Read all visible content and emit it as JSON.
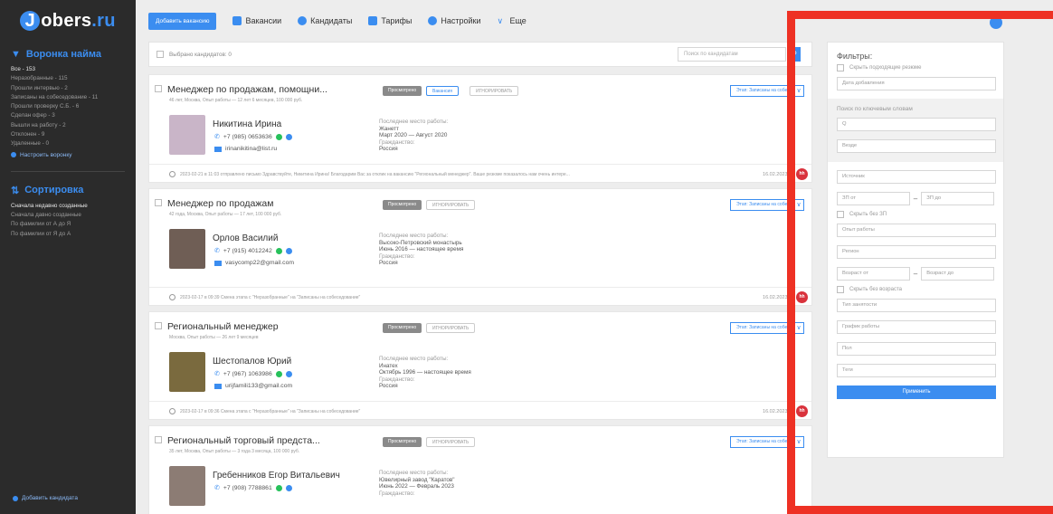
{
  "brand": {
    "logo_j": "J",
    "logo_text": "obers",
    "logo_ru": ".ru"
  },
  "topbar": {
    "add_vacancy": "Добавить вакансию",
    "nav": [
      {
        "label": "Вакансии",
        "icon": "document-icon",
        "color": "#3b8df0"
      },
      {
        "label": "Кандидаты",
        "icon": "people-icon",
        "color": "#3b8df0"
      },
      {
        "label": "Тарифы",
        "icon": "tariff-icon",
        "color": "#3b8df0"
      },
      {
        "label": "Настройки",
        "icon": "gear-icon",
        "color": "#3b8df0"
      },
      {
        "label": "Еще",
        "icon": "chevron-down-icon",
        "color": "#3b8df0"
      }
    ]
  },
  "sidebar": {
    "funnel_title": "Воронка найма",
    "funnel_items": [
      "Все - 153",
      "Неразобранные - 115",
      "Прошли интервью - 2",
      "Записаны на собеседование - 11",
      "Прошли проверку С.Б. - 6",
      "Сделан офер - 3",
      "Вышли на работу - 2",
      "Отклонен - 9",
      "Удаленные - 0"
    ],
    "funnel_setup": "Настроить воронку",
    "sort_title": "Сортировка",
    "sort_items": [
      "Сначала недавно созданные",
      "Сначала давно созданные",
      "По фамилии от А до Я",
      "По фамилии от Я до А"
    ],
    "add_candidate": "Добавить кандидата"
  },
  "list": {
    "selected": "Выбрано кандидатов: 0",
    "search_placeholder": "Поиск по кандидатам",
    "search_icon": "🔍"
  },
  "cards": [
    {
      "title": "Менеджер по продажам, помощни...",
      "meta": "46 лет, Москва, Опыт работы — 12 лет 6 месяцев, 100 000 руб.",
      "tags": [
        "Просмотрено",
        "Вакансия",
        "ИГНОРИРОВАТЬ"
      ],
      "stage": "Этап: Записаны на собеседование",
      "name": "Никитина Ирина",
      "phone": "+7 (985) 0653636",
      "email": "irinanikitina@list.ru",
      "work_label": "Последнее место работы:",
      "work_company": "Жанетт",
      "work_period": "Март 2020 — Август 2020",
      "citizenship_label": "Гражданство:",
      "citizenship": "Россия",
      "foot": "2023-02-21 в 11:03 отправлено письмо Здравствуйте, Никитина Ирина! Благодарим Вас за отклик на вакансию \"Региональный менеджер\". Ваше резюме показалось нам очень интере...",
      "date": "16.02.2023 в",
      "photo_color": "#c9b5c8"
    },
    {
      "title": "Менеджер по продажам",
      "meta": "42 года, Москва, Опыт работы — 17 лет, 100 000 руб.",
      "tags": [
        "Просмотрено",
        "ИГНОРИРОВАТЬ"
      ],
      "stage": "Этап: Записаны на собеседование",
      "name": "Орлов Василий",
      "phone": "+7 (915) 4012242",
      "email": "vasycomp22@gmail.com",
      "work_label": "Последнее место работы:",
      "work_company": "Высоко-Петровский монастырь",
      "work_period": "Июнь 2016 — настоящее время",
      "citizenship_label": "Гражданство:",
      "citizenship": "Россия",
      "foot": "2023-02-17 в 09:39 Смена этапа с \"Неразобранные\" на \"Записаны на собеседование\"",
      "date": "16.02.2023 в",
      "photo_color": "#6f5e55"
    },
    {
      "title": "Региональный менеджер",
      "meta": "Москва, Опыт работы — 26 лет 9 месяцев",
      "tags": [
        "Просмотрено",
        "ИГНОРИРОВАТЬ"
      ],
      "stage": "Этап: Записаны на собеседование",
      "name": "Шестопалов Юрий",
      "phone": "+7 (967) 1063986",
      "email": "urijfamili133@gmail.com",
      "work_label": "Последнее место работы:",
      "work_company": "Инатех",
      "work_period": "Октябрь 1996 — настоящее время",
      "citizenship_label": "Гражданство:",
      "citizenship": "Россия",
      "foot": "2023-02-17 в 09:36 Смена этапа с \"Неразобранные\" на \"Записаны на собеседование\"",
      "date": "16.02.2023 в",
      "photo_color": "#7a6a3e"
    },
    {
      "title": "Региональный торговый предста...",
      "meta": "35 лет, Москва, Опыт работы — 3 года 3 месяца, 100 000 руб.",
      "tags": [
        "Просмотрено",
        "ИГНОРИРОВАТЬ"
      ],
      "stage": "Этап: Записаны на собеседование",
      "name": "Гребенников Егор Витальевич",
      "phone": "+7 (908) 7788861",
      "email": "",
      "work_label": "Последнее место работы:",
      "work_company": "Ювелирный завод \"Каратов\"",
      "work_period": "Июнь 2022 — Февраль 2023",
      "citizenship_label": "Гражданство:",
      "citizenship": "",
      "foot": "",
      "date": "",
      "photo_color": "#8c7c74"
    }
  ],
  "filters": {
    "title": "Фильтры:",
    "hide_suitable": "Скрыть подходящие резюме",
    "date_added": "Дата добавления",
    "keywords_label": "Поиск по ключевым словам",
    "keywords_placeholder": "Q",
    "everywhere": "Везде",
    "source": "Источник",
    "salary_from": "ЗП от",
    "salary_to": "ЗП до",
    "hide_no_salary": "Скрыть без ЗП",
    "experience": "Опыт работы",
    "region": "Регион",
    "age_from": "Возраст от",
    "age_to": "Возраст до",
    "hide_no_age": "Скрыть без возраста",
    "employment": "Тип занятости",
    "schedule": "График работы",
    "gender": "Пол",
    "tags": "Теги",
    "apply": "Применить"
  },
  "highlight_color": "#ee3124",
  "accent_color": "#3b8df0"
}
